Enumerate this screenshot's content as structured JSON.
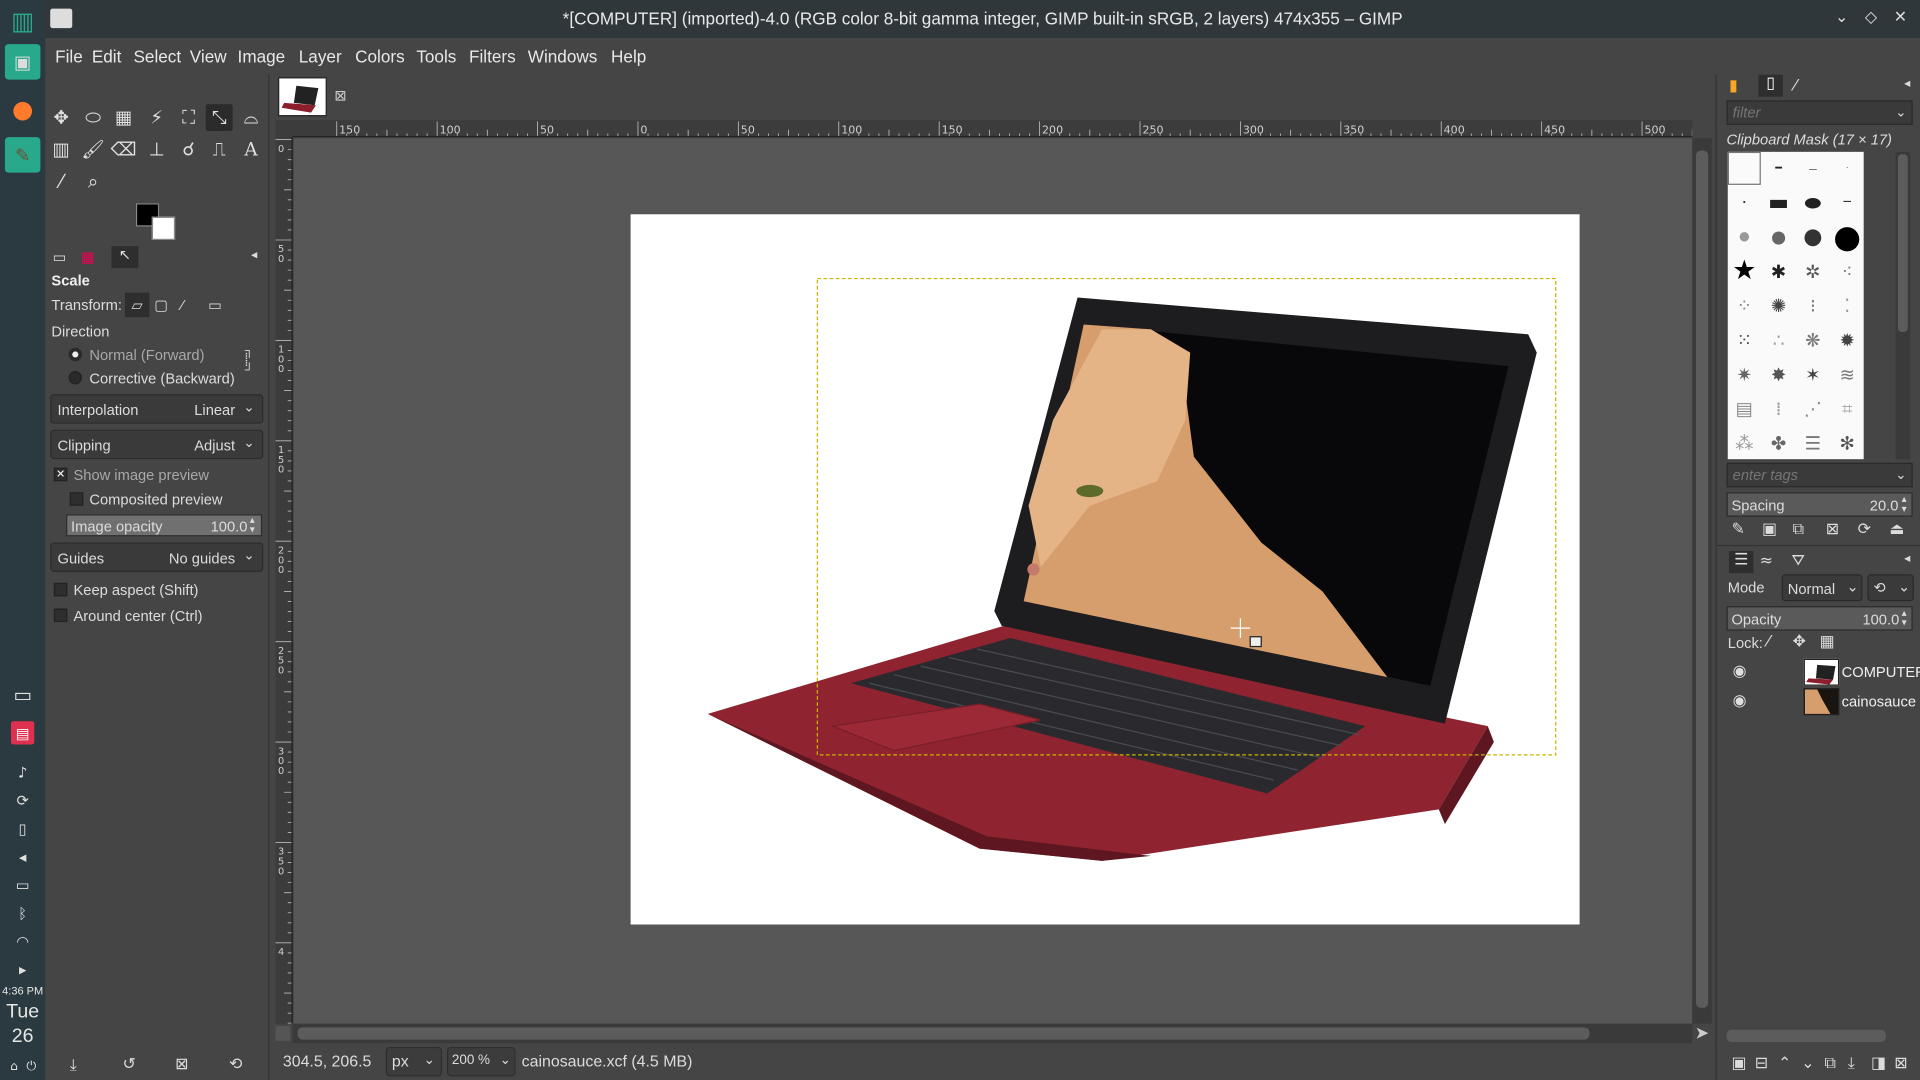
{
  "window": {
    "title": "*[COMPUTER] (imported)-4.0 (RGB color 8-bit gamma integer, GIMP built-in sRGB, 2 layers) 474x355 – GIMP"
  },
  "menu": [
    "File",
    "Edit",
    "Select",
    "View",
    "Image",
    "Layer",
    "Colors",
    "Tools",
    "Filters",
    "Windows",
    "Help"
  ],
  "taskbar": {
    "time": "4:36 PM",
    "day": "Tue",
    "date": "26"
  },
  "tool_options": {
    "title": "Scale",
    "transform_label": "Transform:",
    "direction_label": "Direction",
    "direction_options": [
      "Normal (Forward)",
      "Corrective (Backward)"
    ],
    "interpolation_label": "Interpolation",
    "interpolation_value": "Linear",
    "clipping_label": "Clipping",
    "clipping_value": "Adjust",
    "show_preview": "Show image preview",
    "composited_preview": "Composited preview",
    "image_opacity_label": "Image opacity",
    "image_opacity_value": "100.0",
    "guides_label": "Guides",
    "guides_value": "No guides",
    "keep_aspect": "Keep aspect (Shift)",
    "around_center": "Around center (Ctrl)"
  },
  "rulers": {
    "horizontal_ticks": [
      "150",
      "100",
      "50",
      "0",
      "50",
      "100",
      "150",
      "200",
      "250",
      "300",
      "350",
      "400",
      "450",
      "500"
    ],
    "vertical_ticks": [
      "0",
      "50",
      "100",
      "150",
      "200",
      "250",
      "300",
      "350",
      "4"
    ]
  },
  "status": {
    "coords": "304.5, 206.5",
    "unit": "px",
    "zoom": "200 %",
    "file_info": "cainosauce.xcf (4.5 MB)"
  },
  "brushes": {
    "filter_placeholder": "filter",
    "brush_name": "Clipboard Mask (17 × 17)",
    "tags_placeholder": "enter tags",
    "spacing_label": "Spacing",
    "spacing_value": "20.0"
  },
  "layers": {
    "mode_label": "Mode",
    "mode_value": "Normal",
    "opacity_label": "Opacity",
    "opacity_value": "100.0",
    "lock_label": "Lock:",
    "items": [
      {
        "name": "COMPUTER"
      },
      {
        "name": "cainosauce"
      }
    ]
  },
  "icons": {
    "close_tab": "close-icon",
    "eye": "eye-icon"
  }
}
